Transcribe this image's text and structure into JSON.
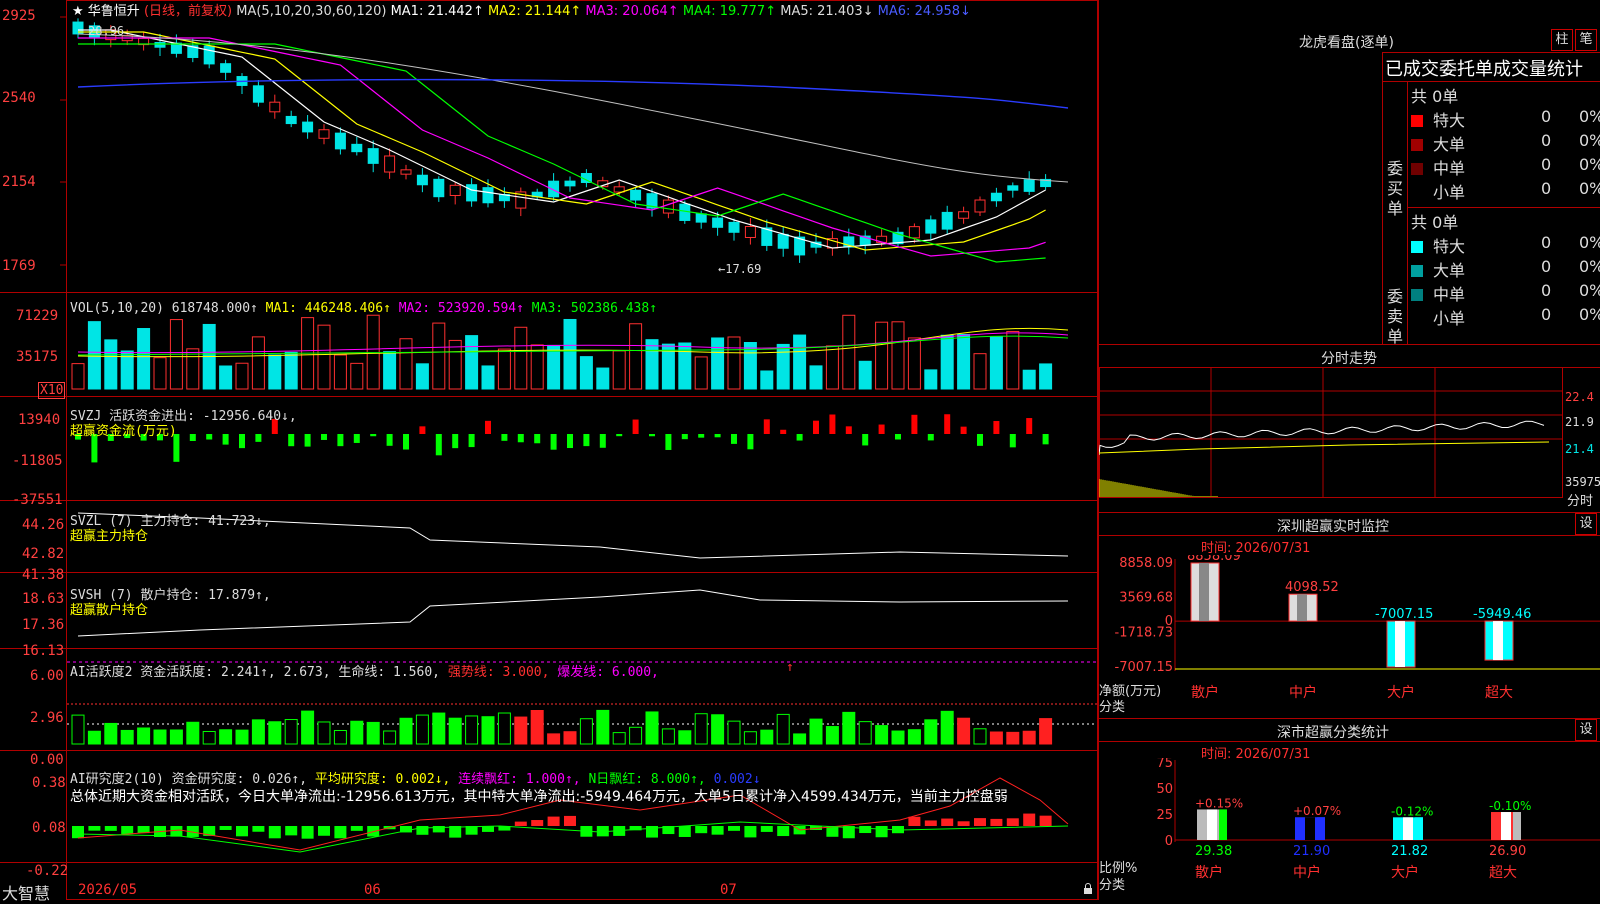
{
  "stock": {
    "star": "★",
    "name": "华鲁恒升",
    "period": "(日线，前复权)"
  },
  "ma_header": {
    "params": "MA(5,10,20,30,60,120)",
    "items": [
      {
        "label": "MA1: 21.442↑",
        "color": "#ffffff"
      },
      {
        "label": "MA2: 21.144↑",
        "color": "#ffff00"
      },
      {
        "label": "MA3: 20.064↑",
        "color": "#ff00ff"
      },
      {
        "label": "MA4: 19.777↑",
        "color": "#00ff00"
      },
      {
        "label": "MA5: 21.403↓",
        "color": "#c0c0c0"
      },
      {
        "label": "MA6: 24.958↓",
        "color": "#2a3cff"
      }
    ]
  },
  "price_axis": [
    "2925",
    "2540",
    "2154",
    "1769"
  ],
  "annotations": {
    "high": "28.96",
    "low": "←17.69"
  },
  "vol": {
    "title": "VOL(5,10,20)",
    "value": "618748.000↑",
    "ma1": "MA1: 446248.406↑",
    "ma2": "MA2: 523920.594↑",
    "ma3": "MA3: 502386.438↑",
    "axis": [
      "71229",
      "35175"
    ],
    "unit": "X10"
  },
  "svzj": {
    "title": "SVZJ  活跃资金进出: -12956.640↓,",
    "sub": "超赢资金流(万元)",
    "axis": [
      "13940",
      "-11805",
      "-37551"
    ]
  },
  "svzl": {
    "title": "SVZL (7) 主力持仓: 41.723↓,",
    "sub": "超赢主力持仓",
    "axis": [
      "44.26",
      "42.82",
      "41.38"
    ]
  },
  "svsh": {
    "title": "SVSH (7) 散户持仓: 17.879↑,",
    "sub": "超赢散户持仓",
    "axis": [
      "18.63",
      "17.36",
      "16.13"
    ]
  },
  "ai1": {
    "title": "AI活跃度2 资金活跃度: 2.241↑, 2.673, 生命线: 1.560,",
    "strong": "强势线: 3.000,",
    "burst": "爆发线: 6.000,",
    "arrow": "↑",
    "axis": [
      "6.00",
      "2.96",
      "0.00"
    ]
  },
  "ai2": {
    "title": "AI研究度2(10) 资金研究度: 0.026↑,",
    "avg": "平均研究度: 0.002↓,",
    "cont": "连续飘红: 1.000↑,",
    "nday": "N日飘红: 8.000↑,",
    "last": "0.002↓",
    "summary": "总体近期大资金相对活跃，今日大单净流出:-12956.613万元，其中特大单净流出:-5949.464万元，大单5日累计净入4599.434万元，当前主力控盘弱",
    "axis": [
      "0.38",
      "0.08",
      "-0.22"
    ]
  },
  "bottom": {
    "app": "大智慧",
    "dates": [
      "2026/05",
      "06",
      "07"
    ]
  },
  "lhb": {
    "title": "龙虎看盘(逐单)",
    "btn1": "柱",
    "btn2": "笔",
    "table_title": "已成交委托单成交量统计",
    "buy": {
      "label": "委买单",
      "total": "共 0单",
      "rows": [
        {
          "name": "特大",
          "vol": "0",
          "pct": "0%",
          "color": "#ff0000"
        },
        {
          "name": "大单",
          "vol": "0",
          "pct": "0%",
          "color": "#a00000"
        },
        {
          "name": "中单",
          "vol": "0",
          "pct": "0%",
          "color": "#700000"
        },
        {
          "name": "小单",
          "vol": "0",
          "pct": "0%",
          "color": ""
        }
      ]
    },
    "sell": {
      "label": "委卖单",
      "total": "共 0单",
      "rows": [
        {
          "name": "特大",
          "vol": "0",
          "pct": "0%",
          "color": "#00ffff"
        },
        {
          "name": "大单",
          "vol": "0",
          "pct": "0%",
          "color": "#00a0a0"
        },
        {
          "name": "中单",
          "vol": "0",
          "pct": "0%",
          "color": "#008080"
        },
        {
          "name": "小单",
          "vol": "0",
          "pct": "0%",
          "color": ""
        }
      ]
    }
  },
  "intraday": {
    "title": "分时走势",
    "axis": [
      "22.4",
      "21.9",
      "21.4",
      "35975"
    ],
    "unit": "分时"
  },
  "monitor": {
    "title": "深圳超赢实时监控",
    "btn": "设",
    "time": "时间: 2026/07/31",
    "axis": [
      "8858.09",
      "3569.68",
      "0",
      "-1718.73",
      "-7007.15"
    ],
    "ylabel": "净额(万元)",
    "xlabel": "分类",
    "cats": [
      "散户",
      "中户",
      "大户",
      "超大"
    ],
    "values": [
      8858.09,
      4098.52,
      -7007.15,
      -5949.46
    ],
    "labels": [
      "8858.09",
      "4098.52",
      "-7007.15",
      "-5949.46"
    ]
  },
  "stats": {
    "title": "深市超赢分类统计",
    "btn": "设",
    "time": "时间: 2026/07/31",
    "axis": [
      "75",
      "50",
      "25",
      "0"
    ],
    "ylabel": "比例%",
    "xlabel": "分类",
    "cats": [
      "散户",
      "中户",
      "大户",
      "超大"
    ],
    "pct": [
      "+0.15%",
      "+0.07%",
      "-0.12%",
      "-0.10%"
    ],
    "values": [
      29.38,
      21.9,
      21.82,
      26.9
    ],
    "labels": [
      "29.38",
      "21.90",
      "21.82",
      "26.90"
    ]
  },
  "colors": {
    "up": "#ff3030",
    "down": "#00e5e5",
    "grid": "#b00000",
    "axis_text": "#ff4040"
  }
}
